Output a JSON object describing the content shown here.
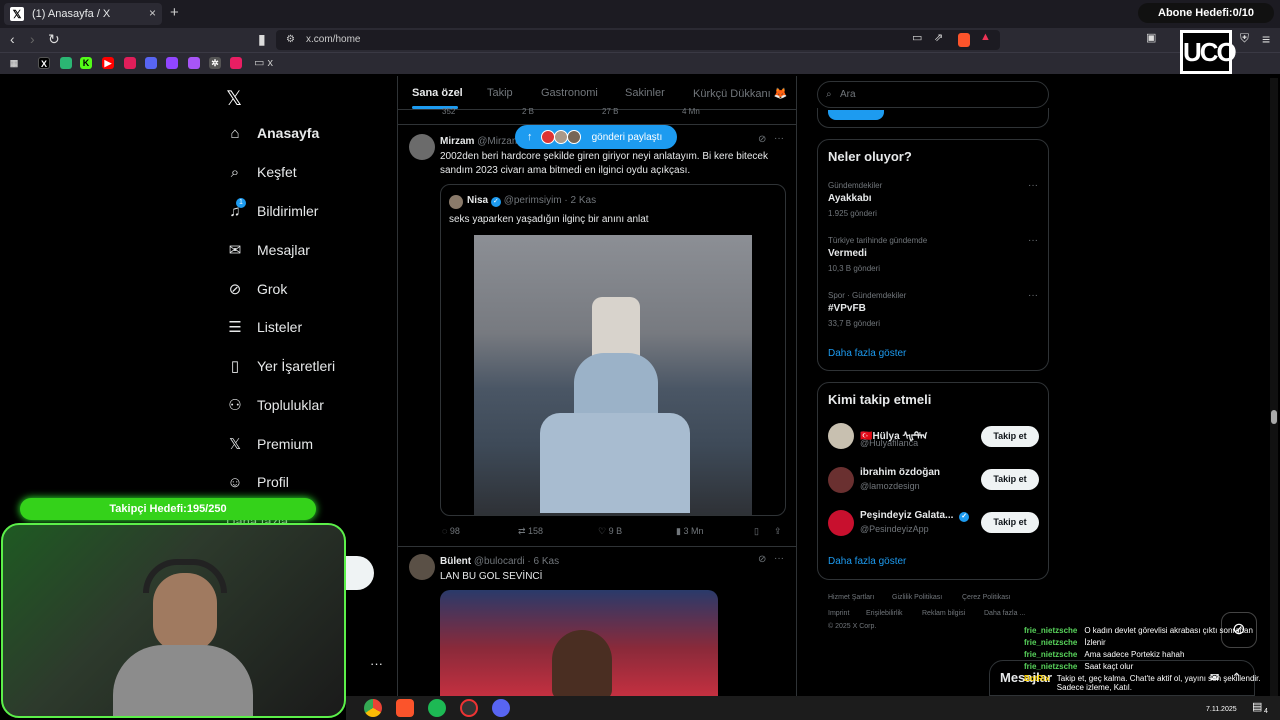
{
  "browser": {
    "tab_title": "(1) Anasayfa / X",
    "url": "x.com/home",
    "abone_hedefi": "Abone Hedefi:0/10",
    "new_tab": "+",
    "close_tab": "×",
    "bookmark_folder": "x"
  },
  "nav": {
    "items": [
      {
        "label": "Anasayfa",
        "icon": "home-icon"
      },
      {
        "label": "Keşfet",
        "icon": "search-icon"
      },
      {
        "label": "Bildirimler",
        "icon": "bell-icon"
      },
      {
        "label": "Mesajlar",
        "icon": "mail-icon"
      },
      {
        "label": "Grok",
        "icon": "grok-icon"
      },
      {
        "label": "Listeler",
        "icon": "list-icon"
      },
      {
        "label": "Yer İşaretleri",
        "icon": "bookmark-icon"
      },
      {
        "label": "Topluluklar",
        "icon": "people-icon"
      },
      {
        "label": "Premium",
        "icon": "x-icon"
      },
      {
        "label": "Profil",
        "icon": "person-icon"
      }
    ],
    "more_partial": "Daha fazla",
    "notification_badge": "1"
  },
  "feed": {
    "tabs": [
      "Sana özel",
      "Takip",
      "Gastronomi",
      "Sakinler",
      "Kürkçü Dükkanı 🦊"
    ],
    "share_pill": "gönderi paylaştı",
    "top_counts": [
      "352",
      "2 B",
      "27 B",
      "4 Mn"
    ],
    "tweet1": {
      "name": "Mirzam",
      "handle": "@Mirzam",
      "text": "2002den beri hardcore şekilde giren giriyor neyi anlatayım. Bi kere bitecek sandım 2023 civarı ama bitmedi en ilginci oydu açıkçası.",
      "quote": {
        "name": "Nisa",
        "handle": "@perimsiyim",
        "time": "· 2 Kas",
        "text": "seks yaparken yaşadığın ilginç bir anını anlat"
      },
      "replies": "98",
      "retweets": "158",
      "likes": "9 B",
      "views": "3 Mn"
    },
    "tweet2": {
      "name": "Bülent",
      "handle": "@bulocardi",
      "time": "· 6 Kas",
      "text": "LAN BU GOL SEVİNCİ"
    }
  },
  "right": {
    "search_placeholder": "Ara",
    "trends_title": "Neler oluyor?",
    "trends": [
      {
        "category": "Gündemdekiler",
        "name": "Ayakkabı",
        "count": "1.925 gönderi"
      },
      {
        "category": "Türkiye tarihinde gündemde",
        "name": "Vermedi",
        "count": "10,3 B gönderi"
      },
      {
        "category": "Spor · Gündemdekiler",
        "name": "#VPvFB",
        "count": "33,7 B gönderi"
      }
    ],
    "trends_more": "Daha fazla göster",
    "who_title": "Kimi takip etmeli",
    "who": [
      {
        "name": "🇹🇷Hülya ᠰᡁᠲᡃᠬ",
        "handle": "@Hulyafilanca",
        "button": "Takip et"
      },
      {
        "name": "ibrahim özdoğan",
        "handle": "@lamozdesign",
        "button": "Takip et"
      },
      {
        "name": "Peşindeyiz Galata...",
        "handle": "@PesindeyizApp",
        "button": "Takip et"
      }
    ],
    "who_more": "Daha fazla göster",
    "footer": [
      "Hizmet Şartları",
      "Gizlilik Politikası",
      "Çerez Politikası",
      "Imprint",
      "Erişilebilirlik",
      "Reklam bilgisi",
      "Daha fazla ...",
      "© 2025 X Corp."
    ]
  },
  "overlay": {
    "takipci": "Takipçi Hedefi:195/250",
    "mesajlar": "Mesajlar",
    "chat": [
      {
        "user": "frie_nietzsche",
        "msg": "O kadın devlet görevlisi akrabası çıktı sonradan"
      },
      {
        "user": "frie_nietzsche",
        "msg": "İzlenir"
      },
      {
        "user": "frie_nietzsche",
        "msg": "Ama sadece Portekiz hahah"
      },
      {
        "user": "frie_nietzsche",
        "msg": "Saat kaçt olur"
      },
      {
        "user": "BotRix",
        "msg": "Takip et, geç kalma. Chat'te aktif ol, yayını sen şekillendir. Sadece izleme, Katıl."
      }
    ]
  },
  "taskbar": {
    "date": "7.11.2025",
    "notif_count": "4"
  },
  "colors": {
    "accent": "#1d9bf0",
    "green": "#34d21a",
    "border": "#2f3336"
  }
}
